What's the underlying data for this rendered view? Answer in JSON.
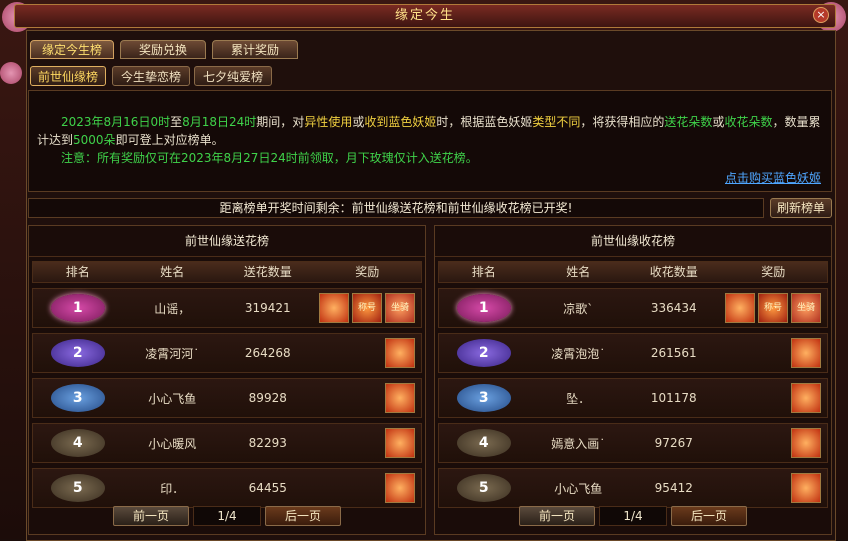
{
  "window": {
    "title": "缘定今生",
    "close_label": "×"
  },
  "tabs": [
    {
      "label": "缘定今生榜",
      "active": true
    },
    {
      "label": "奖励兑换",
      "active": false
    },
    {
      "label": "累计奖励",
      "active": false
    }
  ],
  "subtabs": [
    {
      "label": "前世仙缘榜",
      "active": true
    },
    {
      "label": "今生挚恋榜",
      "active": false
    },
    {
      "label": "七夕纯爱榜",
      "active": false
    }
  ],
  "notice": {
    "p1_date": "2023年8月16日0时",
    "p1_to": "至",
    "p1_date2": "8月18日24时",
    "p1_a": "期间，对",
    "p1_b": "异性使用",
    "p1_c": "或",
    "p1_d": "收到蓝色妖姬",
    "p1_e": "时，根据蓝色妖姬",
    "p1_f": "类型不同",
    "p1_g": "，将获得相应的",
    "p1_h": "送花朵数",
    "p1_i": "或",
    "p1_j": "收花朵数",
    "p1_k": "，数量累计达到",
    "p1_l": "5000朵",
    "p1_m": "即可登上对应榜单。",
    "p2": "注意：所有奖励仅可在2023年8月27日24时前领取，月下玫瑰仅计入送花榜。",
    "buy_link": "点击购买蓝色妖姬"
  },
  "timer_text": "距离榜单开奖时间剩余：前世仙缘送花榜和前世仙缘收花榜已开奖!",
  "refresh_label": "刷新榜单",
  "columns": {
    "rank": "排名",
    "name": "姓名",
    "send_count": "送花数量",
    "recv_count": "收花数量",
    "reward": "奖励"
  },
  "send_board": {
    "title": "前世仙缘送花榜",
    "rows": [
      {
        "rank": "1",
        "name": "山谣，",
        "count": "319421"
      },
      {
        "rank": "2",
        "name": "凌霄河河˙",
        "count": "264268"
      },
      {
        "rank": "3",
        "name": "小心飞鱼",
        "count": "89928"
      },
      {
        "rank": "4",
        "name": "小心暖风",
        "count": "82293"
      },
      {
        "rank": "5",
        "name": "印．",
        "count": "64455"
      }
    ],
    "pager": {
      "prev": "前一页",
      "page": "1/4",
      "next": "后一页"
    }
  },
  "recv_board": {
    "title": "前世仙缘收花榜",
    "rows": [
      {
        "rank": "1",
        "name": "凉歌ˋ",
        "count": "336434"
      },
      {
        "rank": "2",
        "name": "凌霄泡泡˙",
        "count": "261561"
      },
      {
        "rank": "3",
        "name": "坠．",
        "count": "101178"
      },
      {
        "rank": "4",
        "name": "嫣意入画˙",
        "count": "97267"
      },
      {
        "rank": "5",
        "name": "小心飞鱼",
        "count": "95412"
      }
    ],
    "pager": {
      "prev": "前一页",
      "page": "1/4",
      "next": "后一页"
    }
  },
  "reward_icons": {
    "top": [
      {
        "name": "treasure-chest-icon",
        "text": ""
      },
      {
        "name": "reward-badge-icon",
        "text": "称号"
      },
      {
        "name": "reward-badge-icon",
        "text": "坐骑"
      }
    ],
    "other": [
      {
        "name": "treasure-chest-icon",
        "text": ""
      }
    ]
  }
}
